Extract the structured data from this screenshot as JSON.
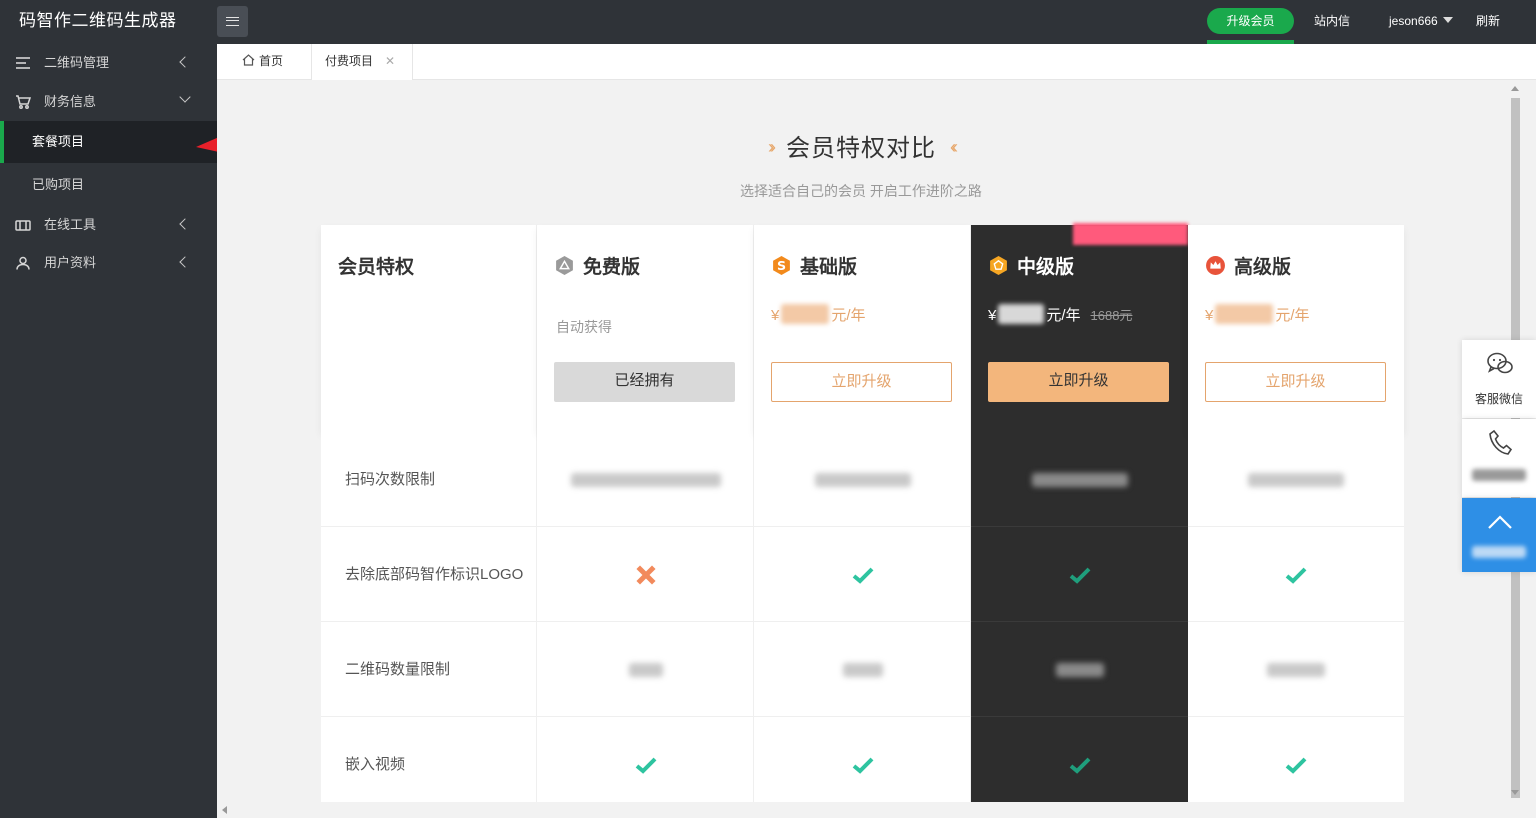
{
  "app": {
    "title": "码智作二维码生成器"
  },
  "topbar": {
    "upgrade_label": "升级会员",
    "messages_label": "站内信",
    "user_label": "jeson666",
    "refresh_label": "刷新"
  },
  "sidebar": {
    "items": [
      {
        "label": "二维码管理",
        "icon": "list-icon"
      },
      {
        "label": "财务信息",
        "icon": "cart-icon"
      },
      {
        "label": "套餐项目",
        "sub": true,
        "active": true
      },
      {
        "label": "已购项目",
        "sub": true
      },
      {
        "label": "在线工具",
        "icon": "tools-icon"
      },
      {
        "label": "用户资料",
        "icon": "user-icon"
      }
    ]
  },
  "tabs": [
    {
      "label": "首页",
      "icon": "home-icon"
    },
    {
      "label": "付费项目",
      "active": true
    }
  ],
  "page": {
    "title": "会员特权对比",
    "subtitle": "选择适合自己的会员 开启工作进阶之路"
  },
  "pricing": {
    "header_label": "会员特权",
    "plans": [
      {
        "name": "免费版",
        "note": "自动获得",
        "button": "已经拥有",
        "badge_color": "#9a9a9a"
      },
      {
        "name": "基础版",
        "currency": "¥",
        "unit": "元/年",
        "button": "立即升级",
        "badge_color": "#f28a1c"
      },
      {
        "name": "中级版",
        "currency": "¥",
        "unit": "元/年",
        "original_price": "1688元",
        "button": "立即升级",
        "badge_color": "#f6a623",
        "highlight": true
      },
      {
        "name": "高级版",
        "currency": "¥",
        "unit": "元/年",
        "button": "立即升级",
        "badge_color": "#e8533a"
      }
    ],
    "features": [
      {
        "label": "扫码次数限制"
      },
      {
        "label": "去除底部码智作标识LOGO"
      },
      {
        "label": "二维码数量限制"
      },
      {
        "label": "嵌入视频"
      }
    ]
  },
  "float_panel": {
    "wechat_label": "客服微信"
  },
  "colors": {
    "accent": "#1aa94c",
    "gold": "#e4a46d",
    "dark_col": "#2d2d2d",
    "check": "#2ec4a0"
  }
}
